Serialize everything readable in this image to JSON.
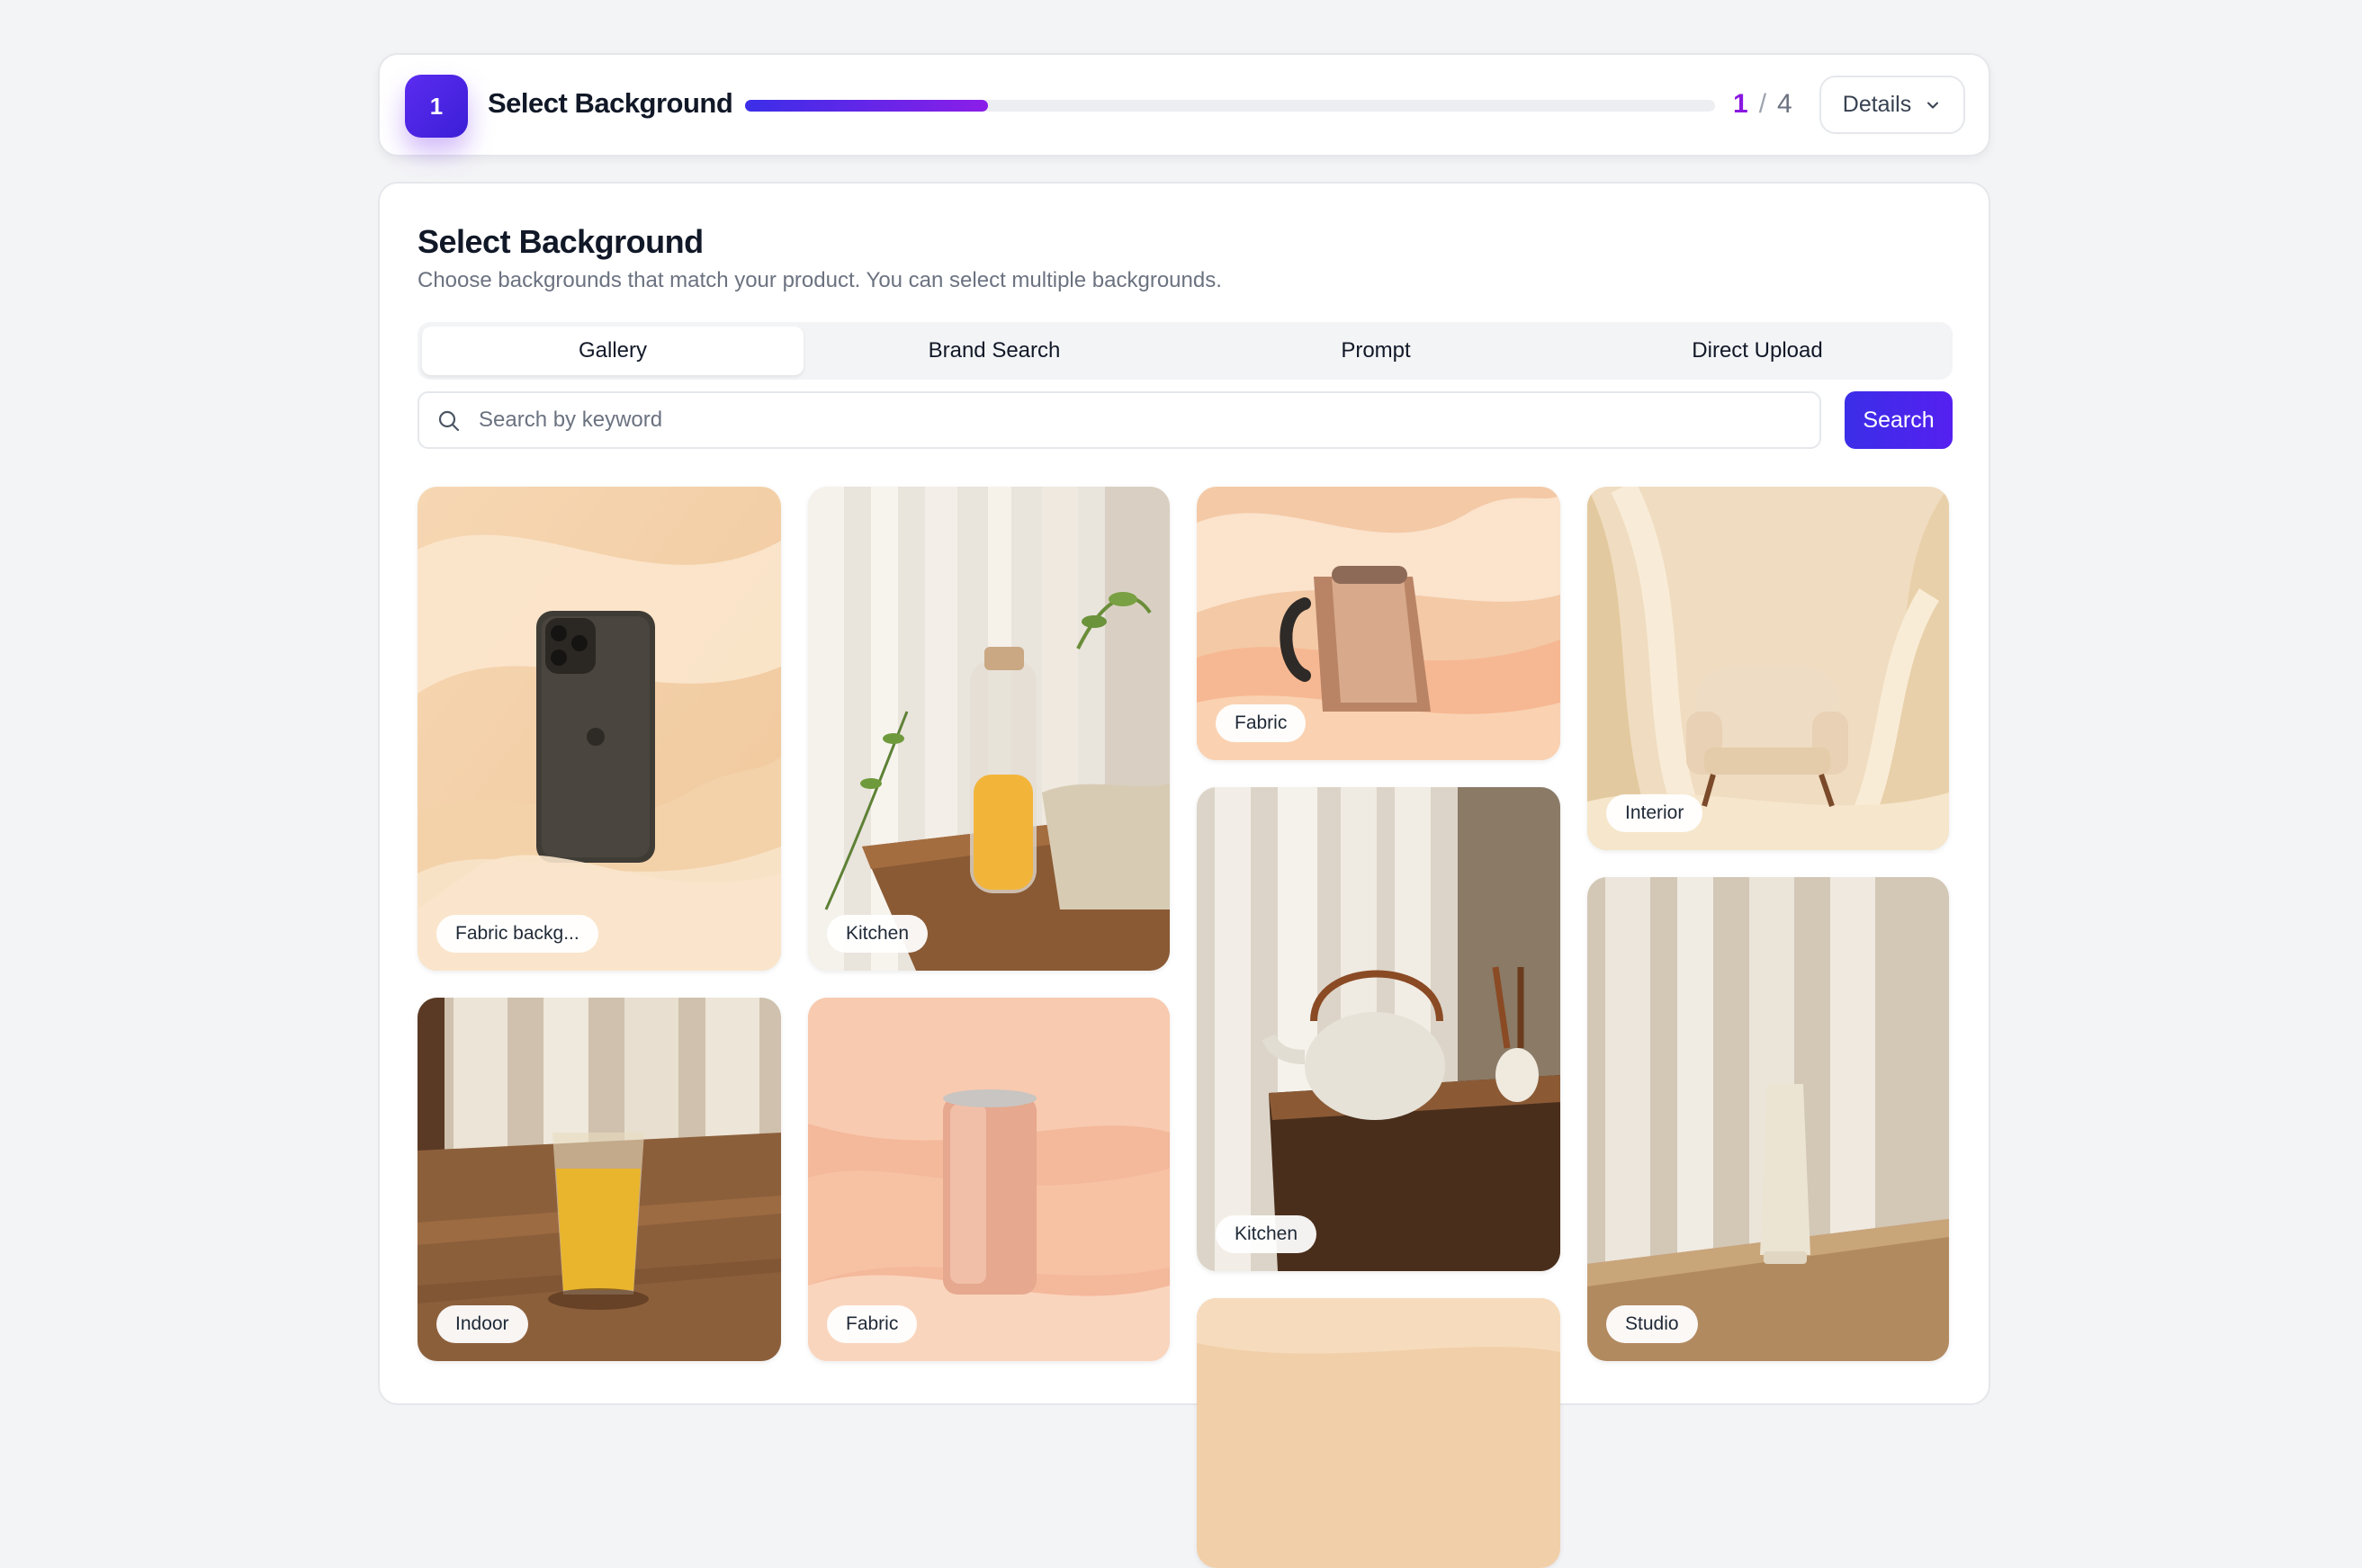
{
  "stepper": {
    "step_number": "1",
    "title": "Select Background",
    "progress": 0.25,
    "current": "1",
    "separator": "/",
    "total": "4",
    "details_label": "Details"
  },
  "panel": {
    "title": "Select Background",
    "subtitle": "Choose backgrounds that match your product. You can select multiple backgrounds.",
    "tabs": [
      {
        "label": "Gallery",
        "active": true
      },
      {
        "label": "Brand Search",
        "active": false
      },
      {
        "label": "Prompt",
        "active": false
      },
      {
        "label": "Direct Upload",
        "active": false
      }
    ],
    "search": {
      "placeholder": "Search by keyword",
      "value": "",
      "button_label": "Search"
    }
  },
  "gallery": [
    {
      "tag": "Fabric backg...",
      "subject": "smartphone on cream fabric"
    },
    {
      "tag": "Kitchen",
      "subject": "juice bottle on wooden table"
    },
    {
      "tag": "Fabric",
      "subject": "kettle on peach fabric"
    },
    {
      "tag": "Interior",
      "subject": "armchair with flowing fabric"
    },
    {
      "tag": "Indoor",
      "subject": "glass of juice on table"
    },
    {
      "tag": "Fabric",
      "subject": "can on peach fabric"
    },
    {
      "tag": "Kitchen",
      "subject": "teapot by window"
    },
    {
      "tag": "Studio",
      "subject": "cosmetic tube on table"
    },
    {
      "tag": "",
      "subject": "peach backdrop"
    }
  ],
  "colors": {
    "accent": "#3b2ee8",
    "accent_purple": "#8a18e0"
  }
}
